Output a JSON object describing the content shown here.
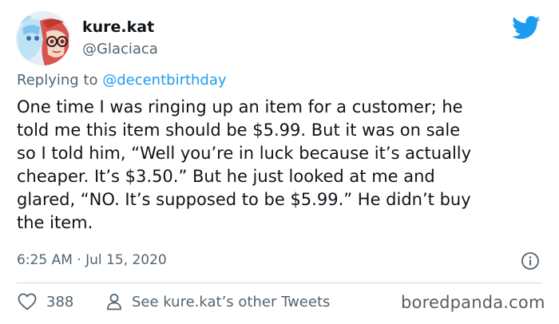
{
  "user": {
    "display_name": "kure.kat",
    "handle": "@Glaciaca"
  },
  "reply": {
    "prefix": "Replying to ",
    "mention": "@decentbirthday"
  },
  "tweet": {
    "lines": [
      "One time I was ringing up an item for a customer; he",
      "told me this item should be $5.99. But it was on sale",
      "so I told him, “Well you’re in luck because it’s actually",
      "cheaper. It’s $3.50.” But he just looked at me and",
      "glared, “NO. It’s supposed to be $5.99.” He didn’t buy",
      "the item."
    ],
    "timestamp": "6:25 AM · Jul 15, 2020"
  },
  "actions": {
    "like_count": "388",
    "see_more_label": "See kure.kat’s other Tweets"
  },
  "watermark": "boredpanda.com",
  "colors": {
    "twitter_blue": "#1d9bf0",
    "secondary_text": "#536471",
    "like_red": "#e0245e"
  },
  "icons": {
    "bird": "twitter-bird-icon",
    "info": "info-icon",
    "like": "heart-icon",
    "profile": "person-icon"
  }
}
